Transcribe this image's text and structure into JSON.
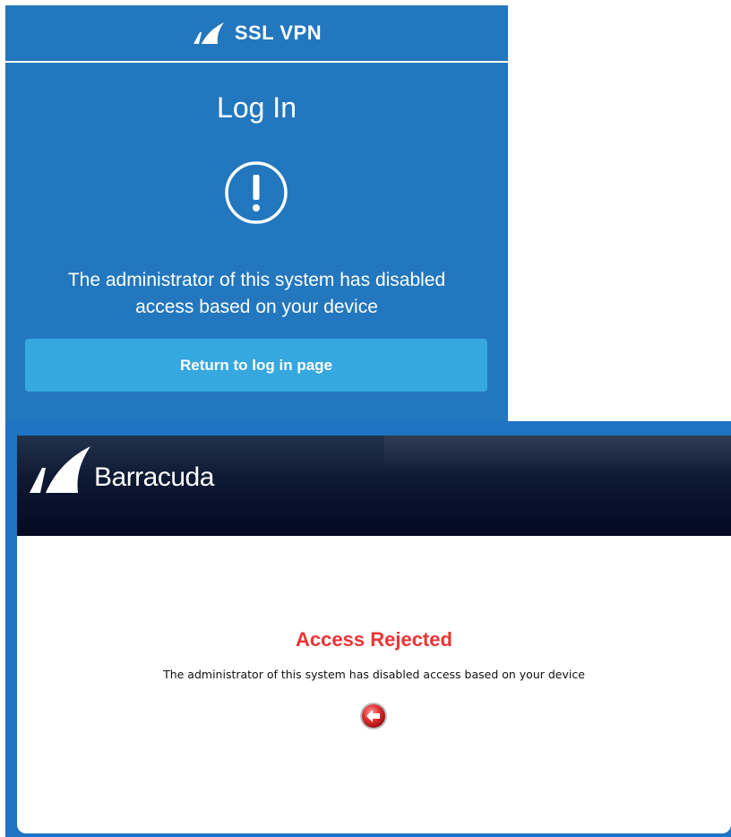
{
  "vpn": {
    "brand": "SSL VPN",
    "title": "Log In",
    "message_line1": "The administrator of this system has disabled",
    "message_line2": "access based on your device",
    "return_button_label": "Return to log in page",
    "logo_icon": "barracuda-fin-icon",
    "alert_icon": "exclamation-circle-icon",
    "colors": {
      "background": "#2277bf",
      "button": "#36a8e0",
      "text": "#ffffff"
    }
  },
  "barracuda": {
    "brand": "Barracuda",
    "title": "Access Rejected",
    "message": "The administrator of this system has disabled access based on your device",
    "logo_icon": "barracuda-fin-icon",
    "back_icon": "back-arrow-icon",
    "colors": {
      "header": "#030a22",
      "title": "#ee3333",
      "frame": "#1e74c2"
    }
  }
}
